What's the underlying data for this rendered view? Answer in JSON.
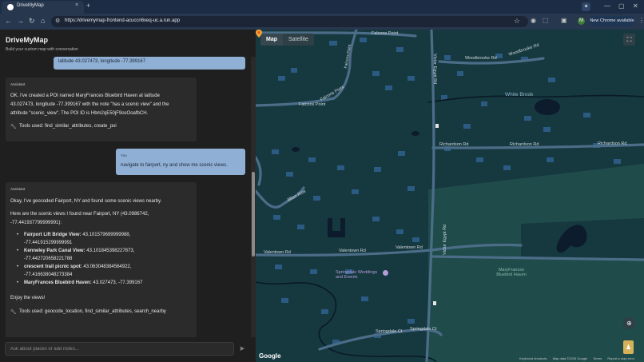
{
  "browser": {
    "tab_title": "DriveMyMap",
    "tab_close": "×",
    "new_tab": "+",
    "url": "https://drivemymap-frontend-acuccn6xeq-uc.a.run.app",
    "update_label": "New Chrome available",
    "profile_initial": "M",
    "icons": [
      "back-icon",
      "forward-icon",
      "reload-icon",
      "home-icon",
      "site-info-icon",
      "bookmark-star-icon",
      "extensions-icon",
      "puzzle-icon",
      "side-panel-icon",
      "more-icon",
      "minimize-icon",
      "maximize-icon",
      "close-icon"
    ]
  },
  "app": {
    "title": "DriveMyMap",
    "subtitle": "Build your custom map with conversation"
  },
  "chat": {
    "prev_user_tail": "latitude 43.027473, longitude -77.399167",
    "msg1": {
      "role": "Assistant",
      "lines": [
        "OK. I've created a POI named MaryFrances Bluebird Haven at latitude",
        "43.027473, longitude -77.399167 with the note \"has a scenic view\" and the",
        "attribute \"scenic_view\". The POI ID is Hbm2qE50jF9osOoafbCH."
      ],
      "tools": "Tools used: find_similar_attributes, create_poi"
    },
    "msg2": {
      "role": "You",
      "text": "navigate to fairport, ny and show me scenic views."
    },
    "msg3": {
      "role": "Assistant",
      "intro": "Okay, I've geocoded Fairport, NY and found some scenic views nearby.",
      "here1": "Here are the scenic views I found near Fairport, NY (43.0986742,",
      "here2": "-77.441937799999991):",
      "items": [
        {
          "name": "Fairport Lift Bridge View:",
          "v1": "43.101579699999988,",
          "v2": "-77.441915299999991"
        },
        {
          "name": "Kenneley Park Canal View:",
          "v1": "43.101845398227873,",
          "v2": "-77.442720658221788"
        },
        {
          "name": "crescent trail picnic spot:",
          "v1": "43.063048384564922,",
          "v2": "-77.416638048273384"
        },
        {
          "name": "MaryFrances Bluebird Haven:",
          "v1": "43.027473, -77.399167",
          "v2": ""
        }
      ],
      "outro": "Enjoy the views!",
      "tools": "Tools used: geocode_location, find_similar_attributes, search_nearby"
    },
    "input_placeholder": "Ask about places or add notes...",
    "send_icon": "send-icon"
  },
  "map": {
    "tabs": [
      "Map",
      "Satellite"
    ],
    "roads": [
      "Falcons Point",
      "Falcons Point",
      "Falcons Point",
      "Woodbrooke Rd",
      "Woodbrooke Rd",
      "Victor Egypt Rd",
      "Richardson Rd",
      "Richardson Rd",
      "Richardson Rd",
      "Jillian Rise",
      "Valentown Rd",
      "Valentown Rd",
      "Valentown Rd",
      "Springdale Ct",
      "Springdale Ct"
    ],
    "water": "White Brook",
    "poi_wedding": "Springdale Weddings and Events",
    "poi_haven": "MaryFrances Bluebird Haven",
    "logo": "Google",
    "attribution": [
      "Keyboard shortcuts",
      "Map data ©2025 Google",
      "Terms",
      "Report a map error"
    ],
    "colors": {
      "background": "#16383f",
      "road": "#4c6d88",
      "park": "#1f4b4b",
      "water": "#0c1c2c"
    }
  }
}
